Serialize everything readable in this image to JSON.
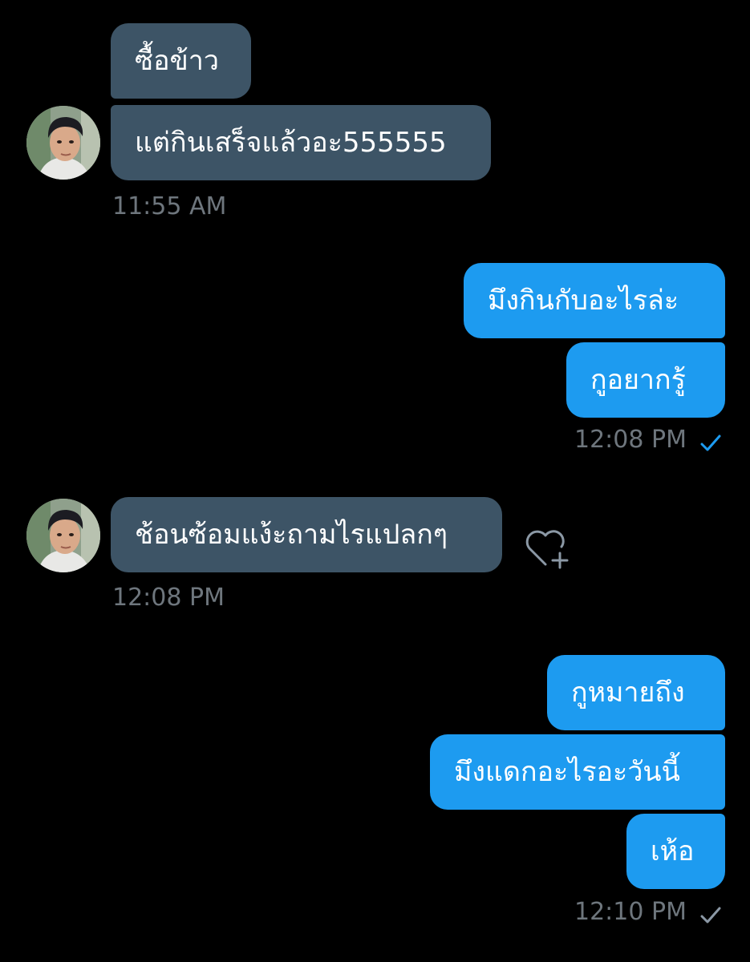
{
  "colors": {
    "background": "#000000",
    "incoming_bubble": "#3d5466",
    "outgoing_bubble": "#1d9bf0",
    "timestamp": "#6e767d",
    "read_check": "#1d9bf0",
    "sent_check": "#8b98a5"
  },
  "messages": [
    {
      "direction": "incoming",
      "text": "ซื้อข้าว"
    },
    {
      "direction": "incoming",
      "text": "แต่กินเสร็จแล้วอะ555555"
    },
    {
      "direction": "outgoing",
      "text": "มึงกินกับอะไรล่ะ"
    },
    {
      "direction": "outgoing",
      "text": "กูอยากรู้"
    },
    {
      "direction": "incoming",
      "text": "ช้อนซ้อมแง้ะถามไรแปลกๆ"
    },
    {
      "direction": "outgoing",
      "text": "กูหมายถึง"
    },
    {
      "direction": "outgoing",
      "text": "มึงแดกอะไรอะวันนี้"
    },
    {
      "direction": "outgoing",
      "text": "เห้อ"
    }
  ],
  "timestamps": [
    {
      "text": "11:55 AM"
    },
    {
      "text": "12:08 PM",
      "status_icon": "check-read-icon"
    },
    {
      "text": "12:08 PM"
    },
    {
      "text": "12:10 PM",
      "status_icon": "check-sent-icon"
    }
  ],
  "icons": {
    "avatar": "contact-avatar",
    "reaction": "add-reaction-heart-icon",
    "read_status": "check-read-icon",
    "sent_status": "check-sent-icon"
  }
}
